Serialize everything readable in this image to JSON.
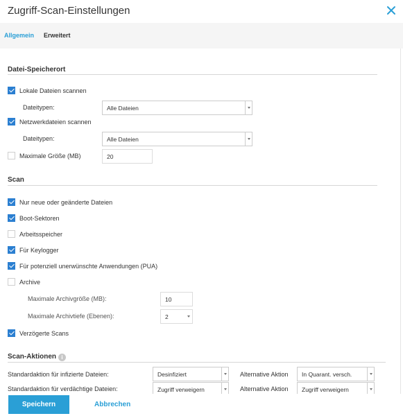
{
  "dialog": {
    "title": "Zugriff-Scan-Einstellungen",
    "close_icon": "close-icon",
    "accent_color": "#2a9fd6",
    "check_color": "#2b7fd1"
  },
  "tabs": [
    {
      "label": "Allgemein",
      "active": true
    },
    {
      "label": "Erweitert",
      "active": false
    }
  ],
  "datei": {
    "title": "Datei-Speicherort",
    "lokal": {
      "label": "Lokale Dateien scannen",
      "checked": true
    },
    "lokal_typen": {
      "label": "Dateitypen:",
      "value": "Alle Dateien"
    },
    "netzwerk": {
      "label": "Netzwerkdateien scannen",
      "checked": true
    },
    "netzwerk_typen": {
      "label": "Dateitypen:",
      "value": "Alle Dateien"
    },
    "max_groesse": {
      "label": "Maximale Größe (MB)",
      "checked": false,
      "value": "20"
    }
  },
  "scan": {
    "title": "Scan",
    "nur_neue": {
      "label": "Nur neue oder geänderte Dateien",
      "checked": true
    },
    "boot": {
      "label": "Boot-Sektoren",
      "checked": true
    },
    "arbeitsspeicher": {
      "label": "Arbeitsspeicher",
      "checked": false
    },
    "keylogger": {
      "label": "Für Keylogger",
      "checked": true
    },
    "pua": {
      "label": "Für potenziell unerwünschte Anwendungen (PUA)",
      "checked": true
    },
    "archive": {
      "label": "Archive",
      "checked": false
    },
    "archiv_groesse": {
      "label": "Maximale Archivgröße (MB):",
      "value": "10"
    },
    "archiv_tiefe": {
      "label": "Maximale Archivtiefe (Ebenen):",
      "value": "2"
    },
    "verzoegert": {
      "label": "Verzögerte Scans",
      "checked": true
    }
  },
  "aktionen": {
    "title": "Scan-Aktionen",
    "info_icon": "info-icon",
    "infiziert": {
      "label": "Standardaktion für infizierte Dateien:",
      "value": "Desinfiziert",
      "alt_label": "Alternative Aktion",
      "alt_value": "In Quarant. versch."
    },
    "verdaechtig": {
      "label": "Standardaktion für verdächtige Dateien:",
      "value": "Zugriff verweigern",
      "alt_label": "Alternative Aktion",
      "alt_value": "Zugriff verweigern"
    }
  },
  "footer": {
    "save_label": "Speichern",
    "cancel_label": "Abbrechen"
  }
}
